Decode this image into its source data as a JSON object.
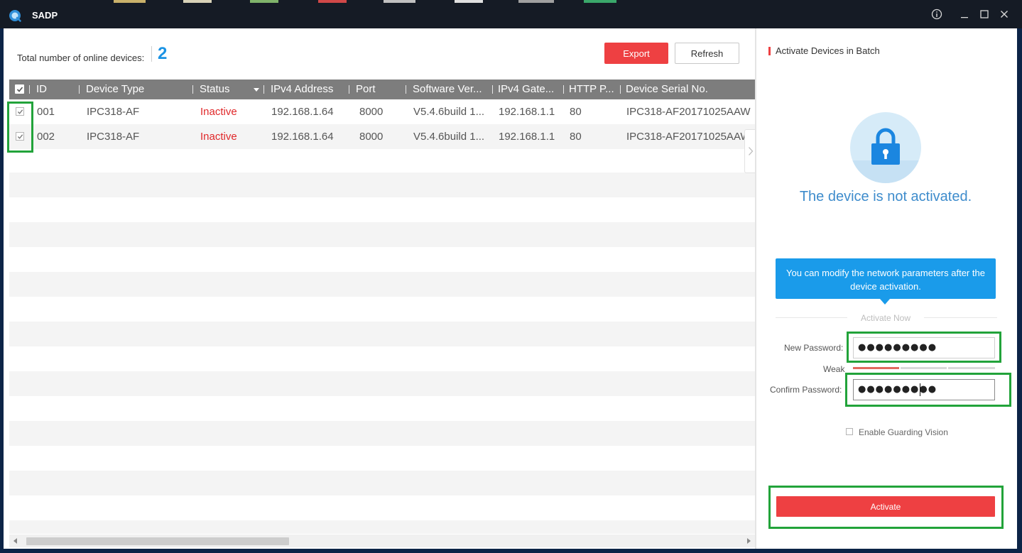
{
  "app": {
    "title": "SADP",
    "window_controls": [
      "info-icon",
      "minimize-icon",
      "maximize-icon",
      "close-icon"
    ]
  },
  "summary": {
    "total_label": "Total number of online devices:",
    "total_count": "2"
  },
  "toolbar": {
    "export_label": "Export",
    "refresh_label": "Refresh"
  },
  "table": {
    "columns": [
      "ID",
      "Device Type",
      "Status",
      "IPv4 Address",
      "Port",
      "Software Ver...",
      "IPv4 Gate...",
      "HTTP P...",
      "Device Serial No."
    ],
    "rows": [
      {
        "checked": true,
        "id": "001",
        "device_type": "IPC318-AF",
        "status": "Inactive",
        "ipv4": "192.168.1.64",
        "port": "8000",
        "software": "V5.4.6build 1...",
        "gateway": "192.168.1.1",
        "http_port": "80",
        "serial": "IPC318-AF20171025AAW"
      },
      {
        "checked": true,
        "id": "002",
        "device_type": "IPC318-AF",
        "status": "Inactive",
        "ipv4": "192.168.1.64",
        "port": "8000",
        "software": "V5.4.6build 1...",
        "gateway": "192.168.1.1",
        "http_port": "80",
        "serial": "IPC318-AF20171025AAW"
      }
    ]
  },
  "panel": {
    "title": "Activate Devices in Batch",
    "not_activated": "The device is not activated.",
    "tip": "You can modify the network parameters after the device activation.",
    "activate_now": "Activate Now",
    "new_password_label": "New Password:",
    "new_password_value": "●●●●●●●●●",
    "strength_label": "Weak",
    "confirm_password_label": "Confirm Password:",
    "confirm_password_value": "●●●●●●●●●",
    "guarding_label": "Enable Guarding Vision",
    "activate_label": "Activate"
  },
  "colors": {
    "accent_red": "#ee4042",
    "accent_blue": "#1a9bea",
    "highlight_green": "#22a33a",
    "status_inactive": "#e0282a"
  }
}
